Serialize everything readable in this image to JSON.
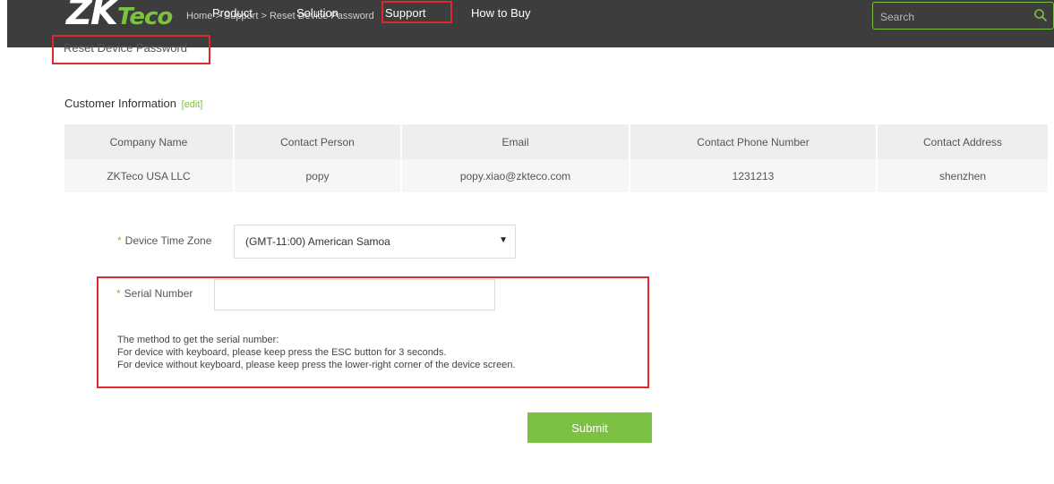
{
  "header": {
    "logo_main": "ZK",
    "logo_accent": "Teco",
    "breadcrumb": "Home > Support > Reset Device Password",
    "nav": [
      {
        "label": "Product"
      },
      {
        "label": "Solution"
      },
      {
        "label": "Support",
        "active": true
      },
      {
        "label": "How to Buy"
      }
    ],
    "search_placeholder": "Search",
    "search_icon": "search-icon"
  },
  "page_title": "Reset Device Password",
  "customer_info": {
    "title": "Customer Information",
    "edit_label": "[edit]",
    "columns": [
      "Company Name",
      "Contact Person",
      "Email",
      "Contact Phone Number",
      "Contact Address"
    ],
    "row": [
      "ZKTeco USA LLC",
      "popy",
      "popy.xiao@zkteco.com",
      "1231213",
      "shenzhen"
    ]
  },
  "form": {
    "required_mark": "*",
    "timezone_label": "Device Time Zone",
    "timezone_value": "(GMT-11:00) American Samoa",
    "serial_label": "Serial Number",
    "serial_value": "",
    "help_lines": [
      "The method to get the serial number:",
      "For device with keyboard, please keep press the ESC button for 3 seconds.",
      "For device without keyboard, please keep press the lower-right corner of the device screen."
    ],
    "submit_label": "Submit"
  },
  "colors": {
    "accent": "#7cc242",
    "highlight": "#e0282c",
    "nav_bg": "#3d3d3d"
  }
}
